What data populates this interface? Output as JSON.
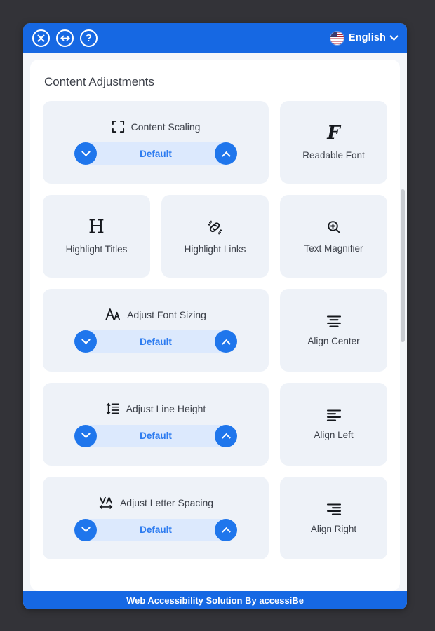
{
  "colors": {
    "accent": "#1668e3",
    "step_button": "#1f76ec",
    "stepper_track": "#dce9fd",
    "stepper_value_text": "#2c7bf0",
    "card_bg": "#eef2f8",
    "panel_bg": "#ffffff",
    "page_bg": "#333338",
    "text": "#3c4049"
  },
  "header": {
    "close_icon": "close-icon",
    "resize_icon": "resize-horizontal-icon",
    "help_icon": "question-mark-icon",
    "language": {
      "flag_icon": "us-flag-icon",
      "label": "English",
      "chevron_icon": "chevron-down-icon"
    }
  },
  "panel": {
    "title": "Content Adjustments"
  },
  "cards": [
    {
      "id": "content-scaling",
      "type": "stepper",
      "icon": "content-scaling-icon",
      "label": "Content Scaling",
      "value": "Default",
      "decrease_icon": "chevron-down-icon",
      "increase_icon": "chevron-up-icon"
    },
    {
      "id": "readable-font",
      "type": "tile",
      "icon": "readable-font-icon",
      "label": "Readable Font"
    },
    {
      "id": "highlight-titles",
      "type": "tile",
      "icon": "highlight-titles-icon",
      "label": "Highlight Titles"
    },
    {
      "id": "highlight-links",
      "type": "tile",
      "icon": "highlight-links-icon",
      "label": "Highlight Links"
    },
    {
      "id": "text-magnifier",
      "type": "tile",
      "icon": "text-magnifier-icon",
      "label": "Text Magnifier"
    },
    {
      "id": "adjust-font-sizing",
      "type": "stepper",
      "icon": "adjust-font-sizing-icon",
      "label": "Adjust Font Sizing",
      "value": "Default",
      "decrease_icon": "chevron-down-icon",
      "increase_icon": "chevron-up-icon"
    },
    {
      "id": "align-center",
      "type": "tile",
      "icon": "align-center-icon",
      "label": "Align Center"
    },
    {
      "id": "adjust-line-height",
      "type": "stepper",
      "icon": "adjust-line-height-icon",
      "label": "Adjust Line Height",
      "value": "Default",
      "decrease_icon": "chevron-down-icon",
      "increase_icon": "chevron-up-icon"
    },
    {
      "id": "align-left",
      "type": "tile",
      "icon": "align-left-icon",
      "label": "Align Left"
    },
    {
      "id": "adjust-letter-spacing",
      "type": "stepper",
      "icon": "adjust-letter-spacing-icon",
      "label": "Adjust Letter Spacing",
      "value": "Default",
      "decrease_icon": "chevron-down-icon",
      "increase_icon": "chevron-up-icon"
    },
    {
      "id": "align-right",
      "type": "tile",
      "icon": "align-right-icon",
      "label": "Align Right"
    }
  ],
  "footer": {
    "text": "Web Accessibility Solution By accessiBe"
  }
}
